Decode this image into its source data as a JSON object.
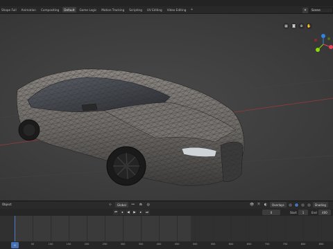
{
  "workspace_tabs": [
    "Shape Full",
    "Animation",
    "Compositing",
    "Default",
    "Game Logic",
    "Motion Tracking",
    "Scripting",
    "UV Editing",
    "Video Editing"
  ],
  "active_tab": "Default",
  "scene": {
    "name": "Scene"
  },
  "timeline": {
    "object_label": "Object",
    "pivot_label": "Global",
    "overlays_label": "Overlays",
    "shading_label": "Shading",
    "current_frame": "0",
    "start_label": "Start",
    "start_value": "1",
    "end_label": "End",
    "end_value": "400",
    "ticks": [
      "0",
      "50",
      "100",
      "150",
      "200",
      "250",
      "300",
      "350",
      "400",
      "450",
      "500",
      "550",
      "600",
      "650",
      "700",
      "750",
      "800",
      "850"
    ],
    "playhead_label": "0"
  },
  "colors": {
    "accent": "#4772b3",
    "gizmo_x": "#e8445a",
    "gizmo_y": "#8bdc00",
    "gizmo_z": "#2f83e3",
    "x_axis_line": "#9b3b3b"
  },
  "icons": [
    "plus-icon",
    "camera-icon",
    "grid-view-icon",
    "zoom-icon",
    "hand-icon",
    "play-icon",
    "jump-start-icon",
    "jump-end-icon",
    "step-back-icon",
    "step-forward-icon",
    "reverse-play-icon",
    "link-icon",
    "magnet-icon",
    "sphere-icon"
  ]
}
